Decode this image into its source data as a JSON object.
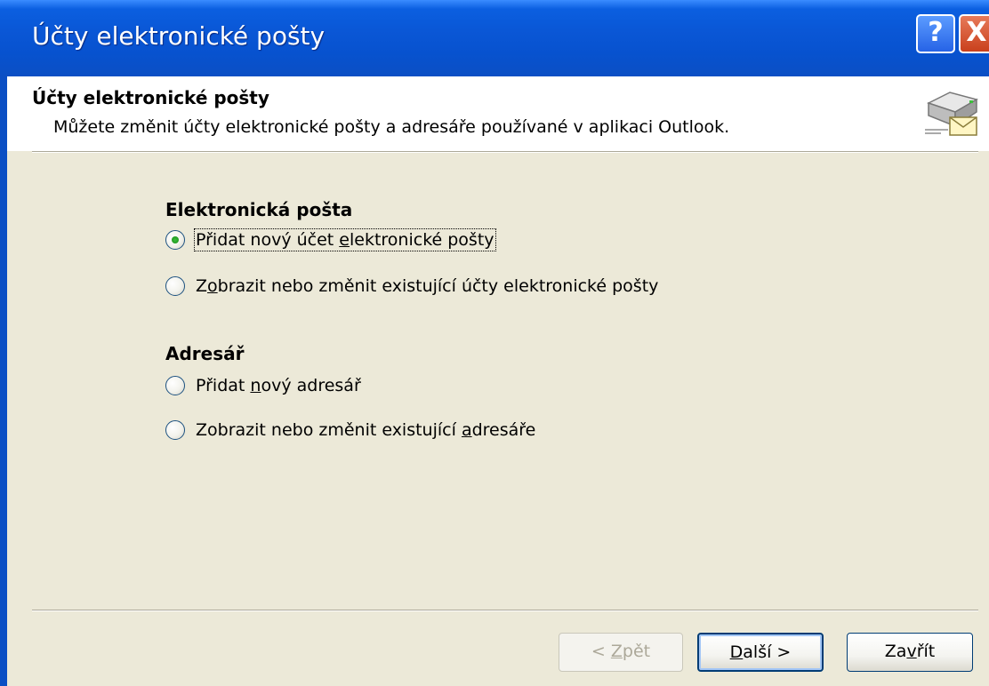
{
  "window": {
    "title": "Účty elektronické pošty",
    "help_label": "?",
    "close_label": "X"
  },
  "header": {
    "title": "Účty elektronické pošty",
    "description": "Můžete změnit účty elektronické pošty a adresáře používané v aplikaci Outlook.",
    "icon": "mail-server-icon"
  },
  "email_group": {
    "label": "Elektronická pošta",
    "options": [
      {
        "pre": "Přidat nový účet ",
        "u": "e",
        "post": "lektronické pošty",
        "checked": true
      },
      {
        "pre": "Z",
        "u": "o",
        "post": "brazit nebo změnit existující účty elektronické pošty",
        "checked": false
      }
    ]
  },
  "addressbook_group": {
    "label": "Adresář",
    "options": [
      {
        "pre": "Přidat ",
        "u": "n",
        "post": "ový adresář",
        "checked": false
      },
      {
        "pre": "Zobrazit nebo změnit existující ",
        "u": "a",
        "post": "dresáře",
        "checked": false
      }
    ]
  },
  "buttons": {
    "back": {
      "pre": "< ",
      "u": "Z",
      "post": "pět"
    },
    "next": {
      "pre": "",
      "u": "D",
      "post": "alší >"
    },
    "close": {
      "pre": "Za",
      "u": "v",
      "post": "řít"
    }
  }
}
